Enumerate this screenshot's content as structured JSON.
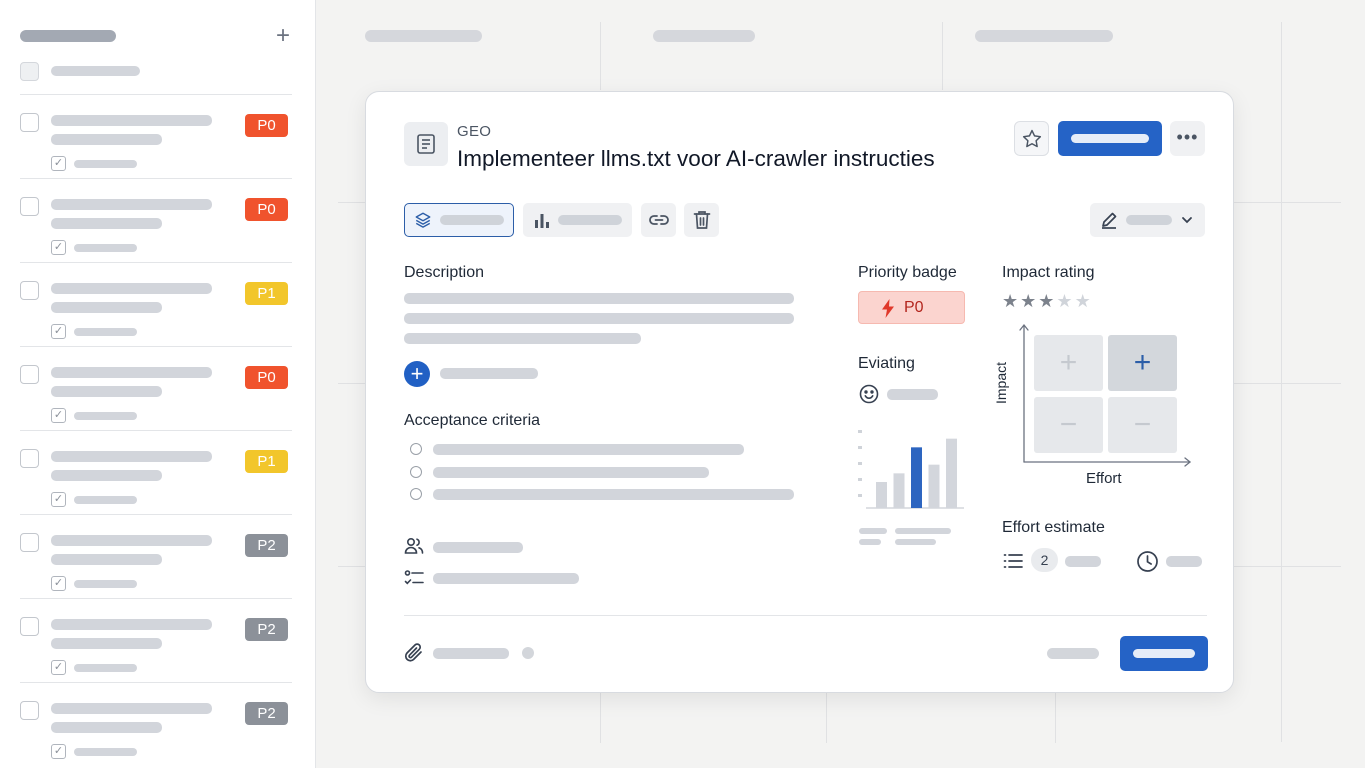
{
  "sidebar": {
    "add_icon": "plus-icon",
    "tasks": [
      {
        "badge": "P0",
        "badge_color": "#f0532d"
      },
      {
        "badge": "P0",
        "badge_color": "#f0532d"
      },
      {
        "badge": "P1",
        "badge_color": "#f2c62b"
      },
      {
        "badge": "P0",
        "badge_color": "#f0532d"
      },
      {
        "badge": "P1",
        "badge_color": "#f2c62b"
      },
      {
        "badge": "P2",
        "badge_color": "#8c9199"
      },
      {
        "badge": "P2",
        "badge_color": "#8c9199"
      },
      {
        "badge": "P2",
        "badge_color": "#8c9199"
      }
    ]
  },
  "modal": {
    "category": "GEO",
    "title": "Implementeer llms.txt voor AI-crawler instructies",
    "icons": {
      "header": "document-icon",
      "favorite": "star-icon",
      "more": "more-horizontal-icon",
      "layers": "layers-icon",
      "chart": "bar-chart-icon",
      "link": "link-icon",
      "delete": "trash-icon",
      "edit": "pencil-icon",
      "dropdown": "chevron-down-icon",
      "add": "plus-circle-icon",
      "people": "users-icon",
      "checklist": "checklist-icon",
      "mood": "smiley-icon",
      "list": "list-icon",
      "time": "clock-icon",
      "attachment": "paperclip-icon"
    },
    "description": {
      "title": "Description"
    },
    "acceptance": {
      "title": "Acceptance criteria"
    },
    "priority": {
      "title": "Priority badge",
      "value": "P0",
      "icon": "lightning-icon",
      "badge_color": "#fbd4cf"
    },
    "evaluating": {
      "title": "Eviating"
    },
    "impact": {
      "title": "Impact rating",
      "rating": 3,
      "max": 5,
      "y_label": "Impact",
      "x_label": "Effort",
      "selected_cell": "high-impact-high-effort"
    },
    "effort": {
      "title": "Effort estimate",
      "count": "2"
    },
    "accent_color": "#2563c6"
  },
  "chart_data": {
    "type": "bar",
    "values": [
      3,
      4,
      7,
      5,
      8
    ],
    "highlight_index": 2,
    "colors": {
      "bar": "#d3d6dc",
      "highlight": "#2d65c0"
    },
    "ylim": [
      0,
      9
    ]
  }
}
